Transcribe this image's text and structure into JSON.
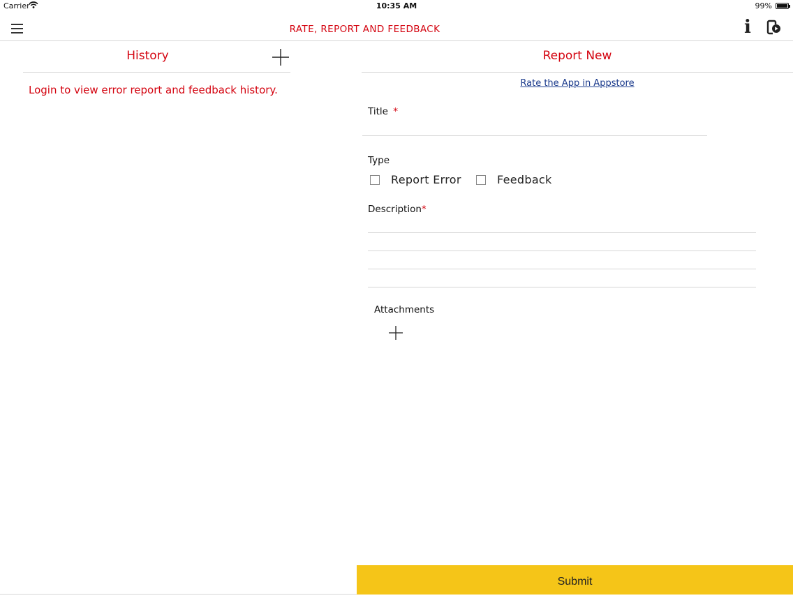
{
  "status_bar": {
    "carrier": "Carrier",
    "time": "10:35 AM",
    "battery": "99%",
    "battery_level": 0.99
  },
  "nav": {
    "title": "RATE, REPORT AND FEEDBACK",
    "icons": [
      "menu-icon",
      "info-icon",
      "device-icon"
    ]
  },
  "history": {
    "title": "History",
    "login_message": "Login to view error report and feedback history."
  },
  "report": {
    "title": "Report New",
    "rate_link": "Rate the App in Appstore",
    "title_label": "Title",
    "required_mark": "*",
    "title_value": "",
    "type_label": "Type",
    "type_options": [
      "Report Error",
      "Feedback"
    ],
    "description_label": "Description",
    "attachments_label": "Attachments",
    "submit_label": "Submit"
  },
  "colors": {
    "accent": "#d40511",
    "submit": "#f5c518",
    "link": "#1a3a8c"
  }
}
